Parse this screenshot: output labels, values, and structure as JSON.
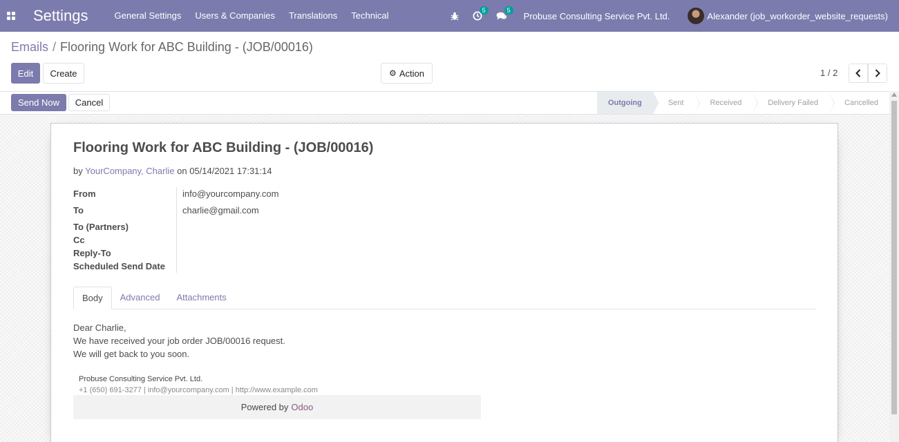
{
  "navbar": {
    "app_title": "Settings",
    "menu": [
      "General Settings",
      "Users & Companies",
      "Translations",
      "Technical"
    ],
    "activity_count": "5",
    "messages_count": "5",
    "company": "Probuse Consulting Service Pvt. Ltd.",
    "user": "Alexander (job_workorder_website_requests)"
  },
  "breadcrumb": {
    "parent": "Emails",
    "separator": "/",
    "current": "Flooring Work for ABC Building - (JOB/00016)"
  },
  "buttons": {
    "edit": "Edit",
    "create": "Create",
    "action": "Action",
    "send_now": "Send Now",
    "cancel": "Cancel"
  },
  "pager": {
    "value": "1 / 2"
  },
  "statusbar": {
    "steps": [
      "Outgoing",
      "Sent",
      "Received",
      "Delivery Failed",
      "Cancelled"
    ],
    "active": "Outgoing"
  },
  "mail": {
    "subject": "Flooring Work for ABC Building - (JOB/00016)",
    "by_prefix": "by",
    "author": "YourCompany, Charlie",
    "date_prefix": "on",
    "date": "05/14/2021 17:31:14",
    "fields": [
      {
        "label": "From",
        "value": "info@yourcompany.com"
      },
      {
        "label": "To",
        "value": "charlie@gmail.com"
      },
      {
        "label": "To (Partners)",
        "value": ""
      },
      {
        "label": "Cc",
        "value": ""
      },
      {
        "label": "Reply-To",
        "value": ""
      },
      {
        "label": "Scheduled Send Date",
        "value": ""
      }
    ],
    "tabs": [
      "Body",
      "Advanced",
      "Attachments"
    ],
    "body_lines": [
      "Dear Charlie,",
      "We have received your job order JOB/00016 request.",
      "We will get back to you soon."
    ],
    "signature_company": "Probuse Consulting Service Pvt. Ltd.",
    "signature_contact": "+1 (650) 691-3277 | info@yourcompany.com | http://www.example.com",
    "powered_by": "Powered by",
    "powered_link": "Odoo"
  },
  "colors": {
    "brand": "#7c7bad",
    "badge": "#00a09d",
    "odoo_link": "#875a7b"
  }
}
